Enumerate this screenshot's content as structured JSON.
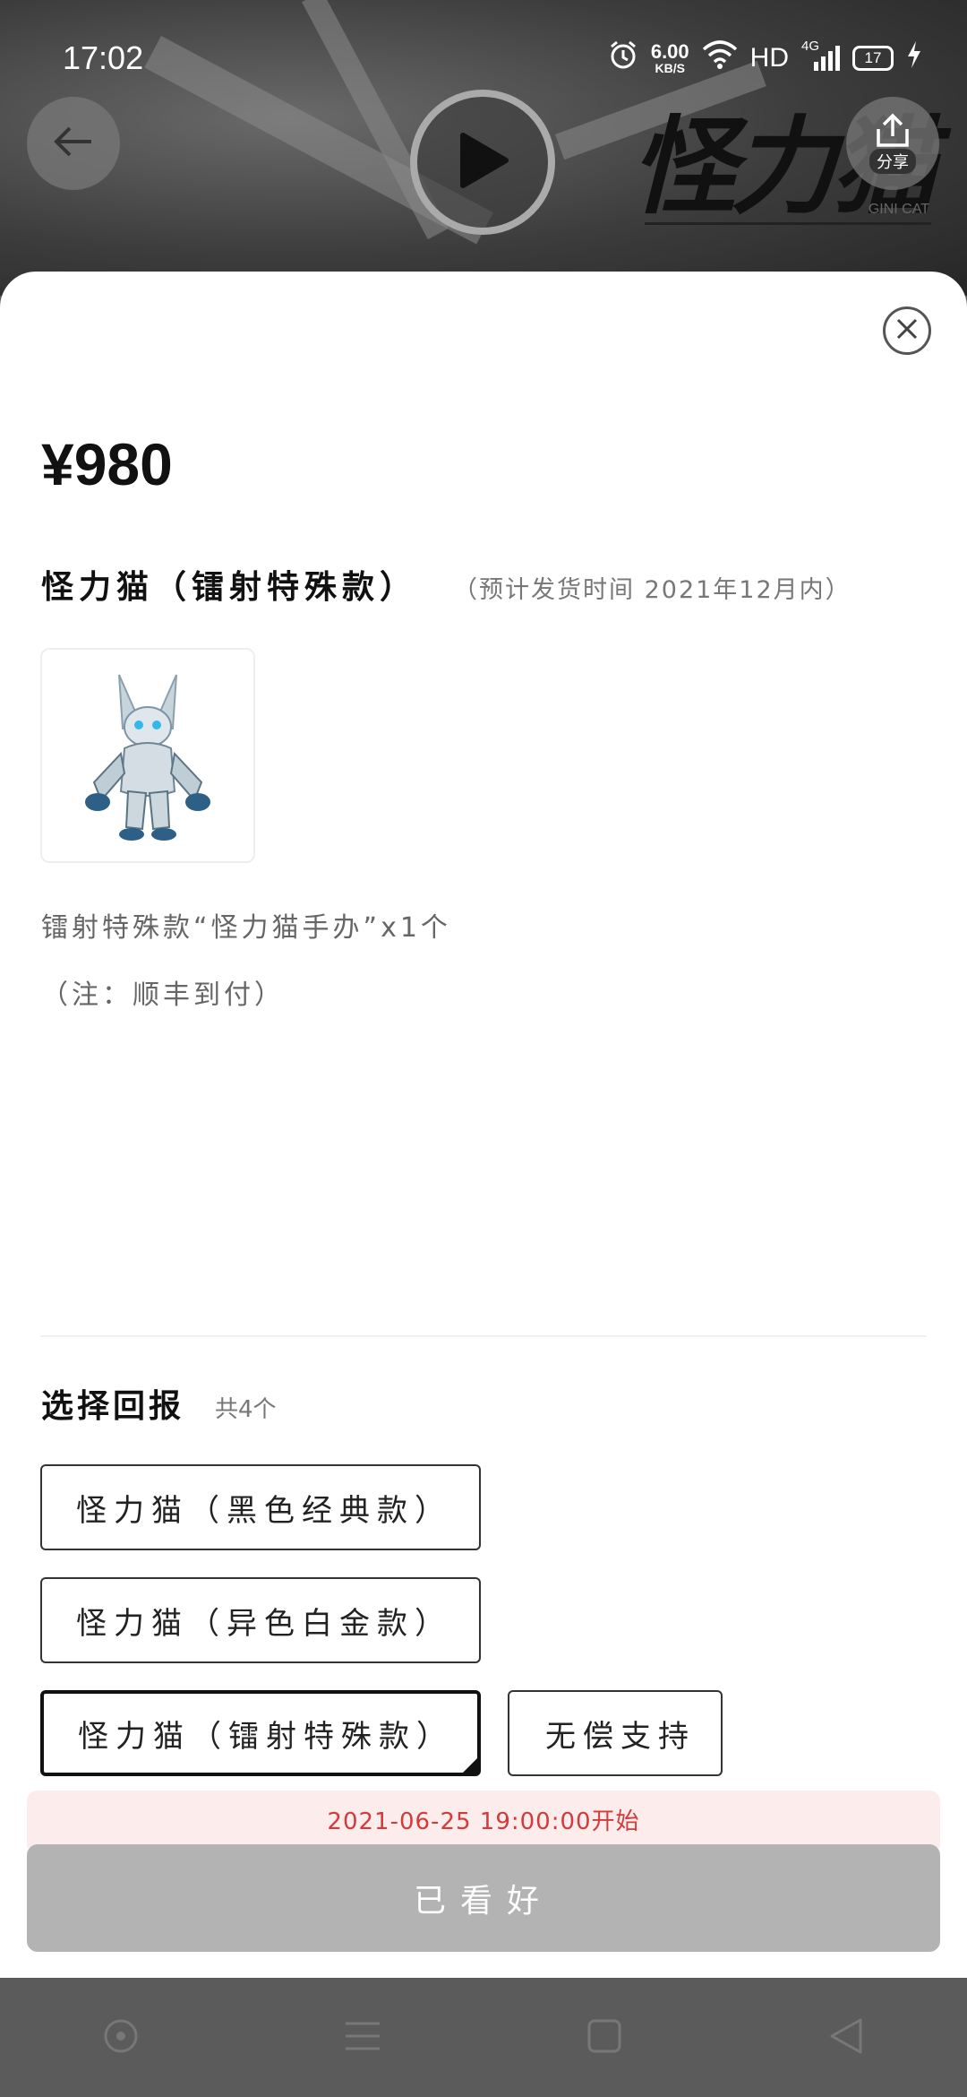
{
  "status_bar": {
    "time": "17:02",
    "net_speed_value": "6.00",
    "net_speed_unit": "KB/S",
    "hd_label": "HD",
    "network_label": "4G",
    "battery_level": "17"
  },
  "header": {
    "brand_logo_text": "怪力猫",
    "brand_sub_text": "GINI CAT",
    "share_label": "分享"
  },
  "product": {
    "price": "¥980",
    "name": "怪力猫（镭射特殊款）",
    "ship_note": "（预计发货时间 2021年12月内）",
    "desc_line1": "镭射特殊款“怪力猫手办”x1个",
    "desc_line2": "（注：顺丰到付）"
  },
  "rewards": {
    "title": "选择回报",
    "count_label": "共4个",
    "options": [
      {
        "label": "怪力猫（黑色经典款）",
        "selected": false
      },
      {
        "label": "怪力猫（异色白金款）",
        "selected": false
      },
      {
        "label": "怪力猫（镭射特殊款）",
        "selected": true
      },
      {
        "label": "无偿支持",
        "selected": false
      }
    ]
  },
  "footer": {
    "start_time_text": "2021-06-25 19:00:00开始",
    "action_label": "已看好"
  },
  "colors": {
    "accent_red": "#d33a3a",
    "banner_bg": "#fdecec",
    "disabled_button": "#b3b3b3"
  }
}
